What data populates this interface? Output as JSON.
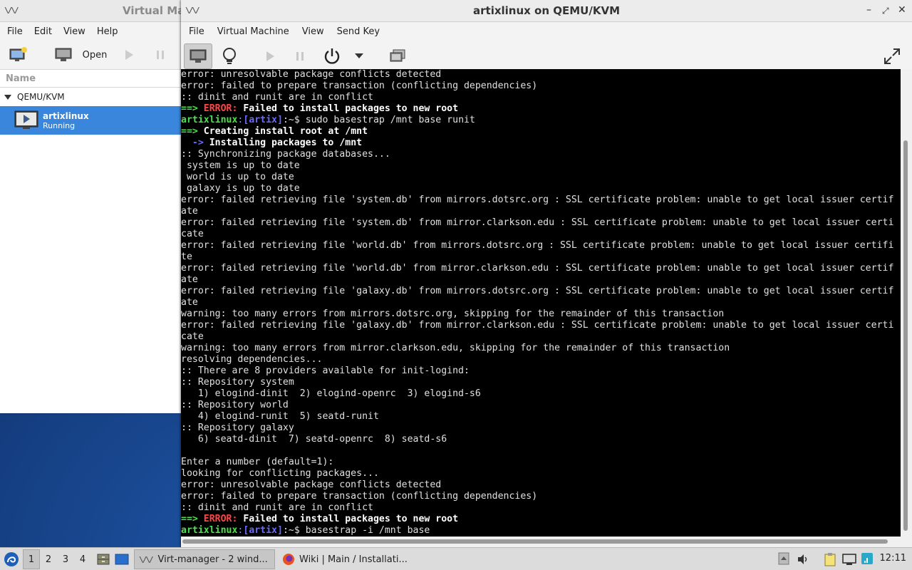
{
  "vmm": {
    "title": "Virtual Ma",
    "menu": [
      "File",
      "Edit",
      "View",
      "Help"
    ],
    "toolbar": {
      "open_label": "Open"
    },
    "list_header": "Name",
    "group": "QEMU/KVM",
    "vm": {
      "name": "artixlinux",
      "status": "Running"
    }
  },
  "console": {
    "title": "artixlinux on QEMU/KVM",
    "menu": [
      "File",
      "Virtual Machine",
      "View",
      "Send Key"
    ]
  },
  "terminal": {
    "lines": [
      [
        {
          "t": "error: unresolvable package conflicts detected"
        }
      ],
      [
        {
          "t": "error: failed to prepare transaction (conflicting dependencies)"
        }
      ],
      [
        {
          "t": ":: dinit and runit are in conflict"
        }
      ],
      [
        {
          "t": "==> ",
          "c": "green"
        },
        {
          "t": "ERROR:",
          "c": "red"
        },
        {
          "t": " Failed to install packages to new root",
          "c": "white"
        }
      ],
      [
        {
          "t": "artixlinux",
          "c": "green"
        },
        {
          "t": ":",
          "c": "lblue"
        },
        {
          "t": "[artix]",
          "c": "blue"
        },
        {
          "t": ":~$ sudo basestrap /mnt base runit"
        }
      ],
      [
        {
          "t": "==> ",
          "c": "green"
        },
        {
          "t": "Creating install root at /mnt",
          "c": "white"
        }
      ],
      [
        {
          "t": "  -> ",
          "c": "blue"
        },
        {
          "t": "Installing packages to /mnt",
          "c": "white"
        }
      ],
      [
        {
          "t": ":: Synchronizing package databases..."
        }
      ],
      [
        {
          "t": " system is up to date"
        }
      ],
      [
        {
          "t": " world is up to date"
        }
      ],
      [
        {
          "t": " galaxy is up to date"
        }
      ],
      [
        {
          "t": "error: failed retrieving file 'system.db' from mirrors.dotsrc.org : SSL certificate problem: unable to get local issuer certif"
        }
      ],
      [
        {
          "t": "ate"
        }
      ],
      [
        {
          "t": "error: failed retrieving file 'system.db' from mirror.clarkson.edu : SSL certificate problem: unable to get local issuer certi"
        }
      ],
      [
        {
          "t": "cate"
        }
      ],
      [
        {
          "t": "error: failed retrieving file 'world.db' from mirrors.dotsrc.org : SSL certificate problem: unable to get local issuer certifi"
        }
      ],
      [
        {
          "t": "te"
        }
      ],
      [
        {
          "t": "error: failed retrieving file 'world.db' from mirror.clarkson.edu : SSL certificate problem: unable to get local issuer certif"
        }
      ],
      [
        {
          "t": "ate"
        }
      ],
      [
        {
          "t": "error: failed retrieving file 'galaxy.db' from mirrors.dotsrc.org : SSL certificate problem: unable to get local issuer certif"
        }
      ],
      [
        {
          "t": "ate"
        }
      ],
      [
        {
          "t": "warning: too many errors from mirrors.dotsrc.org, skipping for the remainder of this transaction"
        }
      ],
      [
        {
          "t": "error: failed retrieving file 'galaxy.db' from mirror.clarkson.edu : SSL certificate problem: unable to get local issuer certi"
        }
      ],
      [
        {
          "t": "cate"
        }
      ],
      [
        {
          "t": "warning: too many errors from mirror.clarkson.edu, skipping for the remainder of this transaction"
        }
      ],
      [
        {
          "t": "resolving dependencies..."
        }
      ],
      [
        {
          "t": ":: There are 8 providers available for init-logind:"
        }
      ],
      [
        {
          "t": ":: Repository system"
        }
      ],
      [
        {
          "t": "   1) elogind-dinit  2) elogind-openrc  3) elogind-s6"
        }
      ],
      [
        {
          "t": ":: Repository world"
        }
      ],
      [
        {
          "t": "   4) elogind-runit  5) seatd-runit"
        }
      ],
      [
        {
          "t": ":: Repository galaxy"
        }
      ],
      [
        {
          "t": "   6) seatd-dinit  7) seatd-openrc  8) seatd-s6"
        }
      ],
      [
        {
          "t": ""
        }
      ],
      [
        {
          "t": "Enter a number (default=1):"
        }
      ],
      [
        {
          "t": "looking for conflicting packages..."
        }
      ],
      [
        {
          "t": "error: unresolvable package conflicts detected"
        }
      ],
      [
        {
          "t": "error: failed to prepare transaction (conflicting dependencies)"
        }
      ],
      [
        {
          "t": ":: dinit and runit are in conflict"
        }
      ],
      [
        {
          "t": "==> ",
          "c": "green"
        },
        {
          "t": "ERROR:",
          "c": "red"
        },
        {
          "t": " Failed to install packages to new root",
          "c": "white"
        }
      ],
      [
        {
          "t": "artixlinux",
          "c": "green"
        },
        {
          "t": ":",
          "c": "lblue"
        },
        {
          "t": "[artix]",
          "c": "blue"
        },
        {
          "t": ":~$ basestrap -i /mnt base"
        }
      ]
    ]
  },
  "taskbar": {
    "workspaces": [
      "1",
      "2",
      "3",
      "4"
    ],
    "tasks": [
      {
        "label": "Virt-manager - 2 wind...",
        "icon": "virt-manager-icon"
      },
      {
        "label": "Wiki | Main / Installati...",
        "icon": "firefox-icon"
      }
    ],
    "clock": "12:11"
  },
  "colors": {
    "selection": "#3a86dd",
    "prompt_green": "#4ee04e",
    "error_red": "#ff4545",
    "arrow_blue": "#6a6aff"
  }
}
